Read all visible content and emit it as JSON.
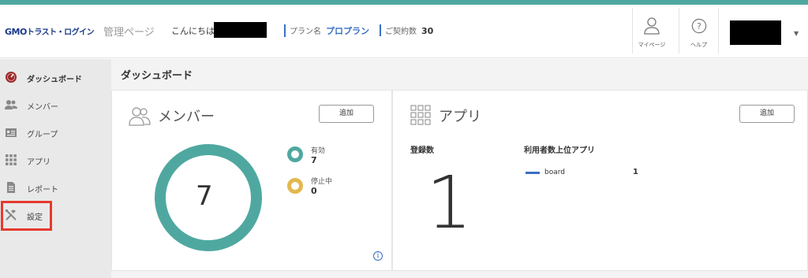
{
  "header": {
    "logo_gmo": "GMO",
    "logo_rest": "トラスト・ログイン",
    "admin_page": "管理ページ",
    "greeting": "こんにちは、",
    "plan_label": "プラン名",
    "plan_value": "プロプラン",
    "contracts_label": "ご契約数",
    "contracts_value": "30",
    "mypage_label": "マイページ",
    "help_label": "ヘルプ"
  },
  "sidebar": {
    "items": [
      {
        "label": "ダッシュボード",
        "icon": "dashboard-icon"
      },
      {
        "label": "メンバー",
        "icon": "members-icon"
      },
      {
        "label": "グループ",
        "icon": "group-icon"
      },
      {
        "label": "アプリ",
        "icon": "apps-icon"
      },
      {
        "label": "レポート",
        "icon": "report-icon"
      },
      {
        "label": "設定",
        "icon": "settings-icon"
      }
    ]
  },
  "main": {
    "title": "ダッシュボード",
    "members_card": {
      "title": "メンバー",
      "add_label": "追加",
      "total": "7",
      "active_label": "有効",
      "active_value": "7",
      "suspended_label": "停止中",
      "suspended_value": "0",
      "info_glyph": "i"
    },
    "apps_card": {
      "title": "アプリ",
      "add_label": "追加",
      "registered_label": "登録数",
      "registered_value": "1",
      "top_apps_label": "利用者数上位アプリ",
      "top_app_name": "board",
      "top_app_count": "1"
    }
  },
  "colors": {
    "accent_teal": "#4fa8a0",
    "suspended_yellow": "#e3b84e",
    "highlight_red": "#e53a2e",
    "brand_blue": "#1a3a8a",
    "dashboard_red": "#9c2a2a"
  }
}
